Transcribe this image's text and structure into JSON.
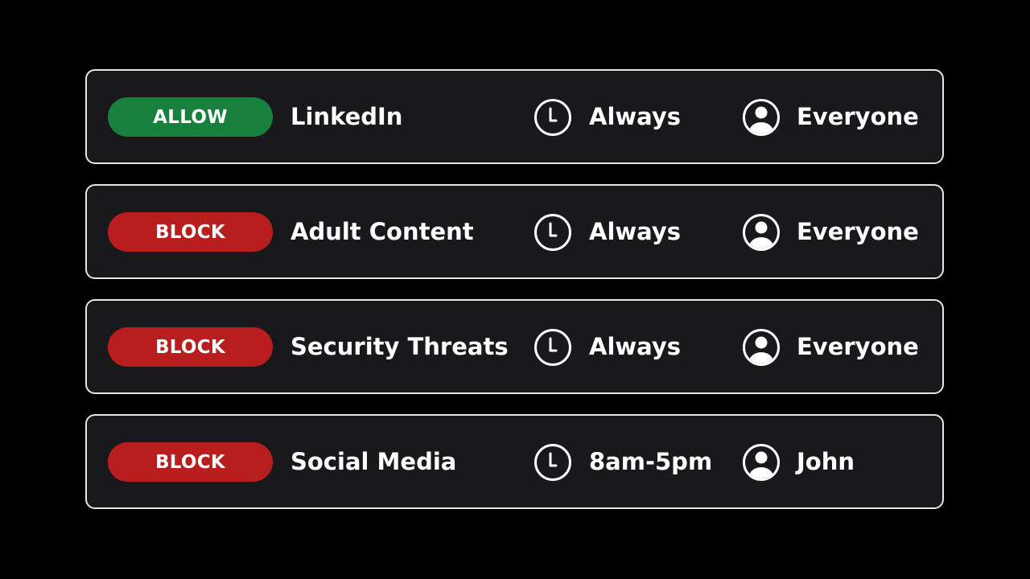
{
  "colors": {
    "allow": "#17803c",
    "block": "#b91e1f",
    "card_bg": "#19191b",
    "card_border": "#e6e6e6"
  },
  "rules": [
    {
      "action": "ALLOW",
      "action_type": "allow",
      "target": "LinkedIn",
      "schedule_icon": "clock-icon",
      "schedule": "Always",
      "user_icon": "user-icon",
      "applies_to": "Everyone"
    },
    {
      "action": "BLOCK",
      "action_type": "block",
      "target": "Adult Content",
      "schedule_icon": "clock-icon",
      "schedule": "Always",
      "user_icon": "user-icon",
      "applies_to": "Everyone"
    },
    {
      "action": "BLOCK",
      "action_type": "block",
      "target": "Security Threats",
      "schedule_icon": "clock-icon",
      "schedule": "Always",
      "user_icon": "user-icon",
      "applies_to": "Everyone"
    },
    {
      "action": "BLOCK",
      "action_type": "block",
      "target": "Social Media",
      "schedule_icon": "clock-icon",
      "schedule": "8am-5pm",
      "user_icon": "user-icon",
      "applies_to": "John"
    }
  ]
}
